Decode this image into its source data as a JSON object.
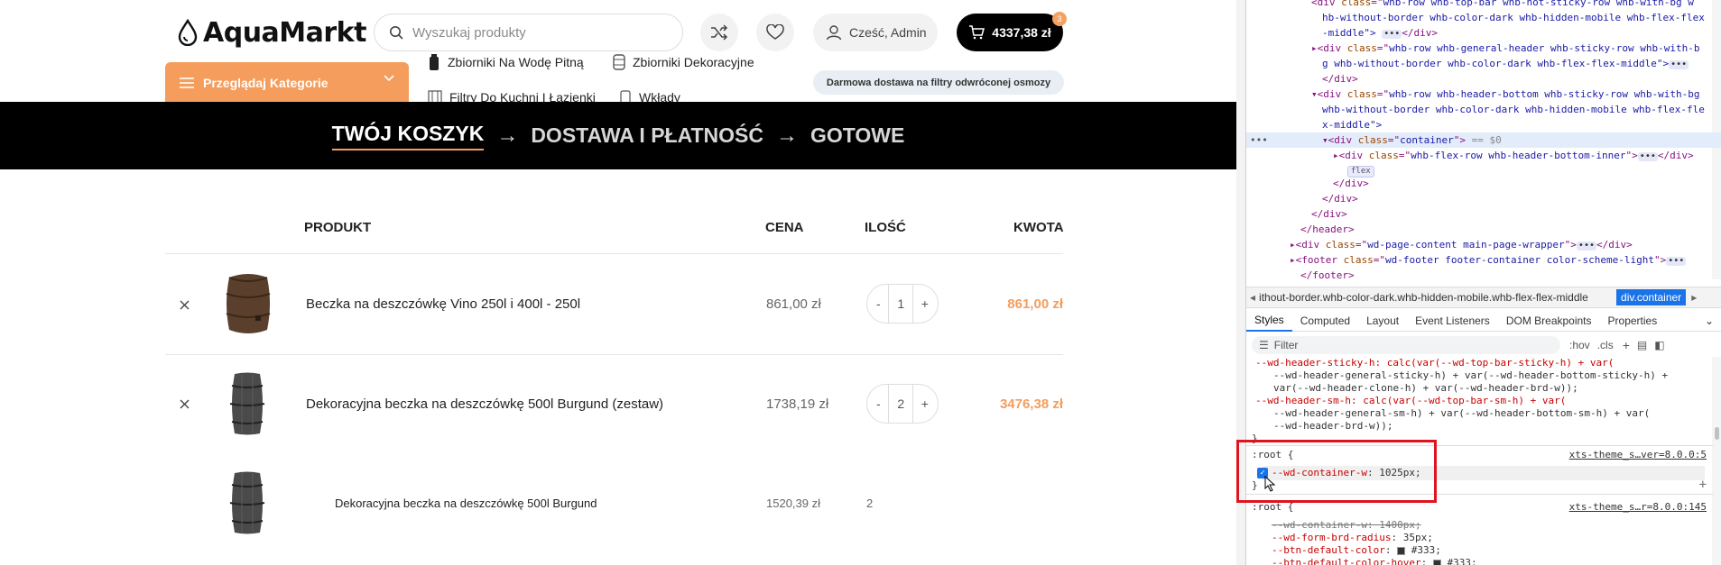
{
  "header": {
    "logo_text": "AquaMarkt",
    "search_placeholder": "Wyszukaj produkty",
    "user_greeting": "Cześć, Admin",
    "cart_total": "4337,38 zł",
    "cart_count": "3",
    "categories_button": "Przeglądaj Kategorie",
    "nav_links": [
      "Zbiorniki Na Wodę Pitną",
      "Zbiorniki Dekoracyjne",
      "Filtry Do Kuchni I Łazienki",
      "Wkłady"
    ],
    "promo": "Darmowa dostawa na filtry odwróconej osmozy"
  },
  "steps": {
    "step1": "TWÓJ KOSZYK",
    "step2": "DOSTAWA I PŁATNOŚĆ",
    "step3": "GOTOWE",
    "arrow": "→"
  },
  "table": {
    "headers": {
      "product": "PRODUKT",
      "price": "CENA",
      "qty": "ILOŚĆ",
      "total": "KWOTA"
    },
    "rows": [
      {
        "name": "Beczka na deszczówkę Vino 250l i 400l - 250l",
        "price": "861,00 zł",
        "qty": "1",
        "total": "861,00 zł"
      },
      {
        "name": "Dekoracyjna beczka na deszczówkę 500l Burgund (zestaw)",
        "price": "1738,19 zł",
        "qty": "2",
        "total": "3476,38 zł"
      },
      {
        "name": "Dekoracyjna beczka na deszczówkę 500l Burgund",
        "price": "1520,39 zł",
        "qty": "2"
      }
    ],
    "minus": "-",
    "plus": "+",
    "remove": "×"
  },
  "devtools": {
    "dom": {
      "l1_attr": "whb-row whb-top-bar whb-not-sticky-row whb-with-bg w",
      "l2": "hb-without-border whb-color-dark whb-hidden-mobile whb-flex-flex",
      "l3": "-middle\">",
      "l4_attr": "whb-row whb-general-header whb-sticky-row whb-with-b",
      "l5": "g whb-without-border whb-color-dark whb-flex-flex-middle\">",
      "l7_attr": "whb-row whb-header-bottom whb-sticky-row whb-with-bg",
      "l8": "whb-without-border whb-color-dark whb-hidden-mobile whb-flex-fle",
      "l9": "x-middle\">",
      "l10_attr": "container",
      "l10_eq": "== $0",
      "l11_attr": "whb-flex-row whb-header-bottom-inner",
      "flex_badge": "flex",
      "main_attr": "wd-page-content main-page-wrapper",
      "footer_attr": "wd-footer footer-container color-scheme-light",
      "close_div": "</div>",
      "close_header": "</header>",
      "close_footer": "</footer>",
      "tag_div_open": "<div ",
      "tag_footer_open": "<footer ",
      "attr_class": "class",
      "eq_quote": "=\"",
      "quote_close": "\">",
      "ellipsis": "•••"
    },
    "breadcrumb": {
      "left": "ithout-border.whb-color-dark.whb-hidden-mobile.whb-flex-flex-middle",
      "right": "div.container"
    },
    "tabs": [
      "Styles",
      "Computed",
      "Layout",
      "Event Listeners",
      "DOM Breakpoints",
      "Properties"
    ],
    "filter_placeholder": "Filter",
    "hov": ":hov",
    "cls": ".cls",
    "css": {
      "c1": "--wd-header-sticky-h: calc(var(--wd-top-bar-sticky-h) + var(",
      "c2": "--wd-header-general-sticky-h) + var(--wd-header-bottom-sticky-h) +",
      "c3": "var(--wd-header-clone-h) + var(--wd-header-brd-w));",
      "c4": "--wd-header-sm-h: calc(var(--wd-top-bar-sm-h) + var(",
      "c5": "--wd-header-general-sm-h) + var(--wd-header-bottom-sm-h) + var(",
      "c6": "--wd-header-brd-w));",
      "close": "}",
      "root": ":root {",
      "src1": "xts-theme_s…ver=8.0.0:5",
      "container_prop": "--wd-container-w",
      "container_val": "1025px;",
      "src2": "xts-theme_s…r=8.0.0:145",
      "strike_prop": "--wd-container-w",
      "strike_val": "1400px;",
      "radius_prop": "--wd-form-brd-radius",
      "radius_val": "35px;",
      "btn_prop": "--btn-default-color",
      "btn_val": "#333;",
      "btn_hover_prop": "--btn-default-color-hover",
      "btn_hover_val": "#333;"
    }
  },
  "colors": {
    "accent": "#f49d5c",
    "black": "#000000",
    "highlight": "#e0141e"
  }
}
